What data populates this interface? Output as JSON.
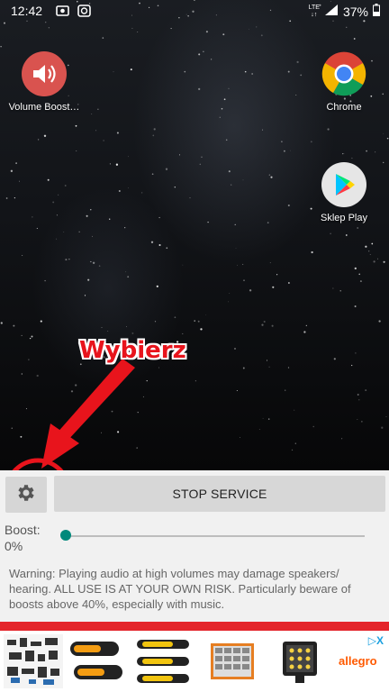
{
  "status_bar": {
    "time": "12:42",
    "network": "LTE",
    "battery": "37%"
  },
  "home": {
    "apps": [
      {
        "label": "Volume Boost…",
        "icon": "speaker-icon"
      },
      {
        "label": "Chrome",
        "icon": "chrome-icon"
      },
      {
        "label": "Sklep Play",
        "icon": "play-store-icon"
      }
    ]
  },
  "annotation": {
    "text": "Wybierz",
    "color": "#e8141c"
  },
  "panel": {
    "settings_icon": "gear-icon",
    "stop_label": "STOP SERVICE",
    "boost_label": "Boost:",
    "boost_value": "0%",
    "slider_value": 0,
    "warning": "Warning: Playing audio at high volumes may damage speakers/ hearing. ALL USE IS AT YOUR OWN RISK. Particularly beware of boosts above 40%, especially with music.",
    "accent": "#00897b"
  },
  "ad": {
    "brand": "allegro",
    "brand_color": "#ff5a00",
    "adchoices_label": "▷X"
  }
}
